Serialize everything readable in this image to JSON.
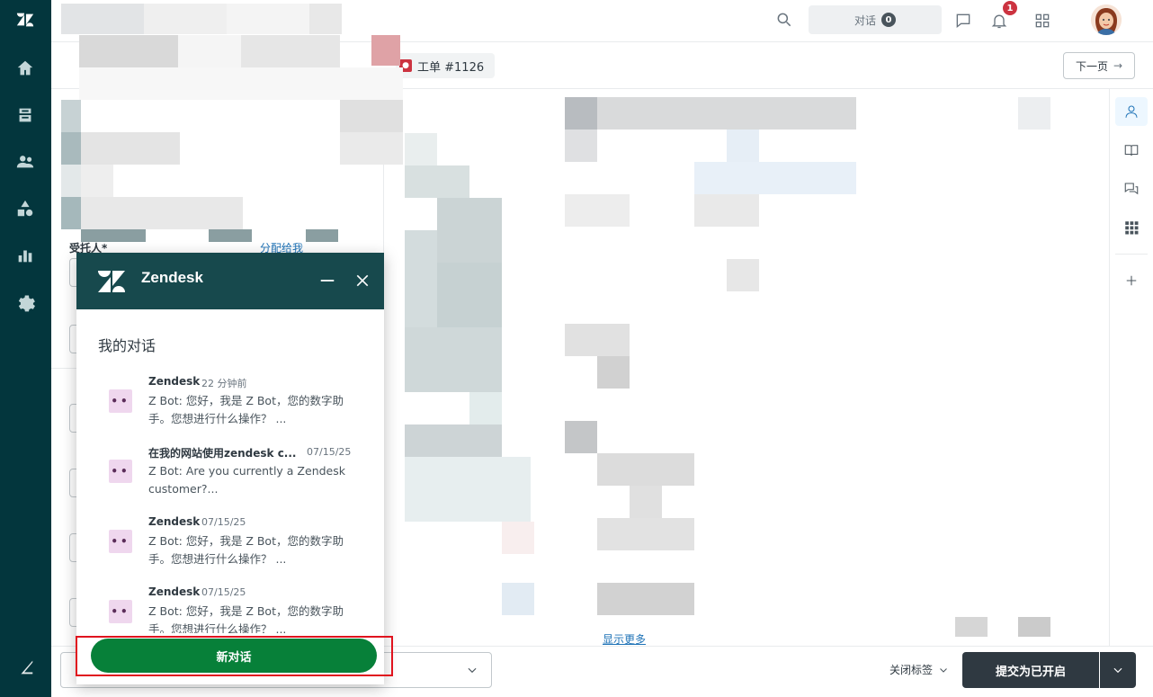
{
  "topbar": {
    "conversations_label": "对话",
    "conversations_count": "0",
    "notification_count": "1"
  },
  "ticket": {
    "tab_label": "工单 #1126",
    "next_label": "下一页"
  },
  "form": {
    "assignee_label": "受托人*",
    "assign_link": "分配给我",
    "show_more": "显示更多"
  },
  "widget": {
    "title": "Zendesk",
    "section_title": "我的对话",
    "conversations": [
      {
        "name": "Zendesk",
        "time": "22 分钟前",
        "message": "Z Bot: 您好，我是 Z Bot，您的数字助手。您想进行什么操作？ ..."
      },
      {
        "name": "在我的网站使用zendesk c...",
        "time": "07/15/25",
        "message": "Z Bot: Are you currently a Zendesk customer?..."
      },
      {
        "name": "Zendesk",
        "time": "07/15/25",
        "message": "Z Bot: 您好，我是 Z Bot，您的数字助手。您想进行什么操作？ ..."
      },
      {
        "name": "Zendesk",
        "time": "07/15/25",
        "message": "Z Bot: 您好，我是 Z Bot，您的数字助手。您想进行什么操作？ ..."
      }
    ],
    "new_conversation_label": "新对话"
  },
  "bottom": {
    "close_tab_label": "关闭标签",
    "submit_label": "提交为已开启"
  },
  "colors": {
    "nav_bg": "#03363d",
    "widget_header": "#17494d",
    "primary_green": "#078039",
    "submit_bg": "#2f3941",
    "highlight": "#e0131e"
  }
}
